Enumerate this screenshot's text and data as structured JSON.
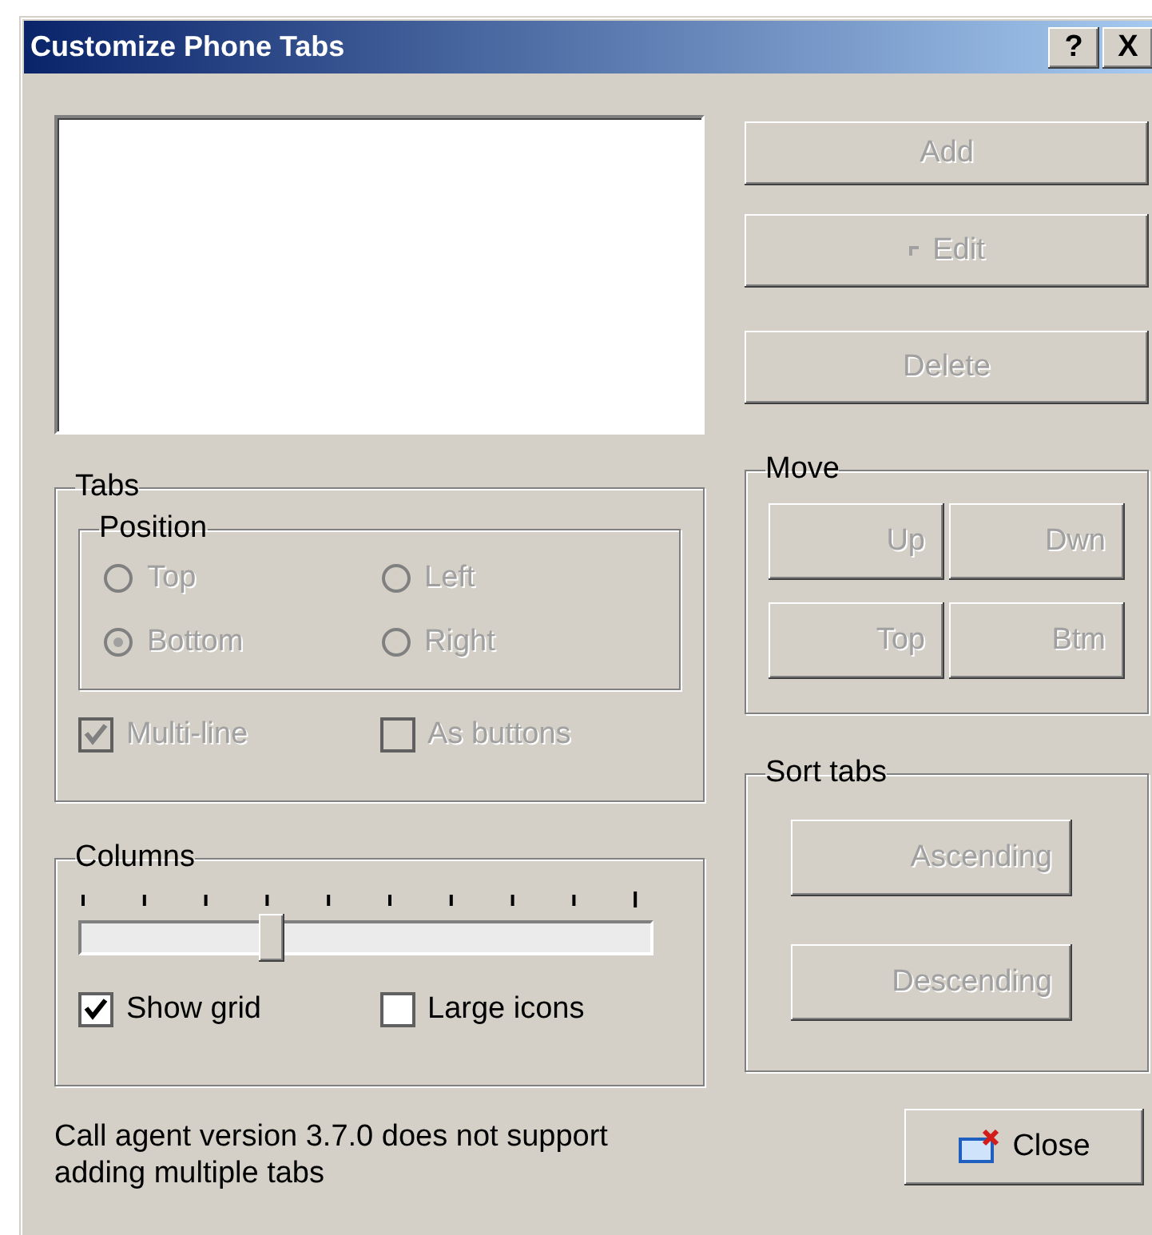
{
  "window": {
    "title": "Customize Phone Tabs",
    "title_buttons": [
      "?",
      "X"
    ]
  },
  "list_buttons": [
    {
      "label": "Add",
      "disabled": true,
      "kind": "plain"
    },
    {
      "label": "Edit",
      "disabled": true,
      "kind": "icon"
    },
    {
      "label": "Delete",
      "disabled": true,
      "kind": "plain"
    }
  ],
  "tabs_group": {
    "title": "Tabs",
    "position": {
      "title": "Position",
      "options": [
        {
          "label": "Top",
          "selected": false,
          "disabled": true
        },
        {
          "label": "Left",
          "selected": false,
          "disabled": true
        },
        {
          "label": "Bottom",
          "selected": true,
          "disabled": true
        },
        {
          "label": "Right",
          "selected": false,
          "disabled": true
        }
      ]
    },
    "options": [
      {
        "label": "Multi-line",
        "checked": true,
        "disabled": true
      },
      {
        "label": "As buttons",
        "checked": false,
        "disabled": true
      }
    ]
  },
  "move_group": {
    "title": "Move",
    "buttons": [
      {
        "label": "Up",
        "disabled": true
      },
      {
        "label": "Dwn",
        "disabled": true
      },
      {
        "label": "Top",
        "disabled": true
      },
      {
        "label": "Btm",
        "disabled": true
      }
    ]
  },
  "columns_group": {
    "title": "Columns",
    "slider": {
      "level": 0.333
    },
    "options": [
      {
        "label": "Show grid",
        "checked": true,
        "disabled": false
      },
      {
        "label": "Large icons",
        "checked": false,
        "disabled": false
      }
    ]
  },
  "sort_group": {
    "title": "Sort tabs",
    "buttons": [
      {
        "label": "Ascending",
        "disabled": true
      },
      {
        "label": "Descending",
        "disabled": true
      }
    ]
  },
  "note": "Call agent version 3.7.0 does not support adding multiple tabs",
  "close_button": {
    "label": "Close",
    "disabled": false
  }
}
